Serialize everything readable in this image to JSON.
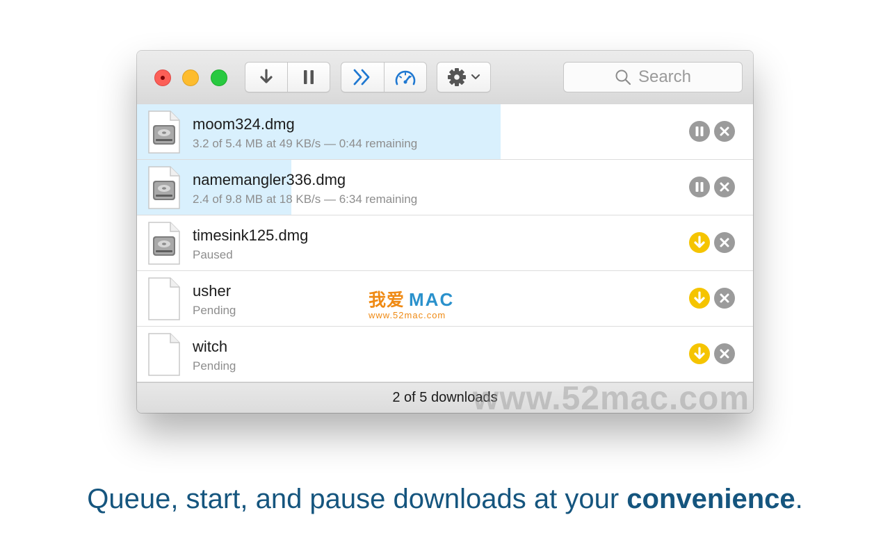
{
  "toolbar": {
    "buttons": [
      "download-all",
      "pause-all",
      "start-queue",
      "speed-limit",
      "settings"
    ],
    "search_placeholder": "Search"
  },
  "downloads": [
    {
      "name": "moom324.dmg",
      "status": "3.2 of 5.4 MB at 49 KB/s — 0:44 remaining",
      "progress": 0.59,
      "state": "downloading",
      "icon": "disk-image-icon"
    },
    {
      "name": "namemangler336.dmg",
      "status": "2.4 of 9.8 MB at 18 KB/s — 6:34 remaining",
      "progress": 0.25,
      "state": "downloading",
      "icon": "disk-image-icon"
    },
    {
      "name": "timesink125.dmg",
      "status": "Paused",
      "progress": 0,
      "state": "paused",
      "icon": "disk-image-icon"
    },
    {
      "name": "usher",
      "status": "Pending",
      "progress": 0,
      "state": "pending",
      "icon": "blank-document-icon"
    },
    {
      "name": "witch",
      "status": "Pending",
      "progress": 0,
      "state": "pending",
      "icon": "blank-document-icon"
    }
  ],
  "statusbar": {
    "text": "2 of 5 downloads"
  },
  "watermark": {
    "cn": "我爱",
    "en": "MAC",
    "url": "www.52mac.com",
    "big": "www.52mac.com"
  },
  "tagline": {
    "normal": "Queue, start, and pause downloads at your ",
    "bold": "convenience",
    "end": "."
  },
  "colors": {
    "progress": "#d9f0fd",
    "resume": "#f5c400",
    "control_gray": "#9b9b9b",
    "tagline": "#15557e"
  }
}
